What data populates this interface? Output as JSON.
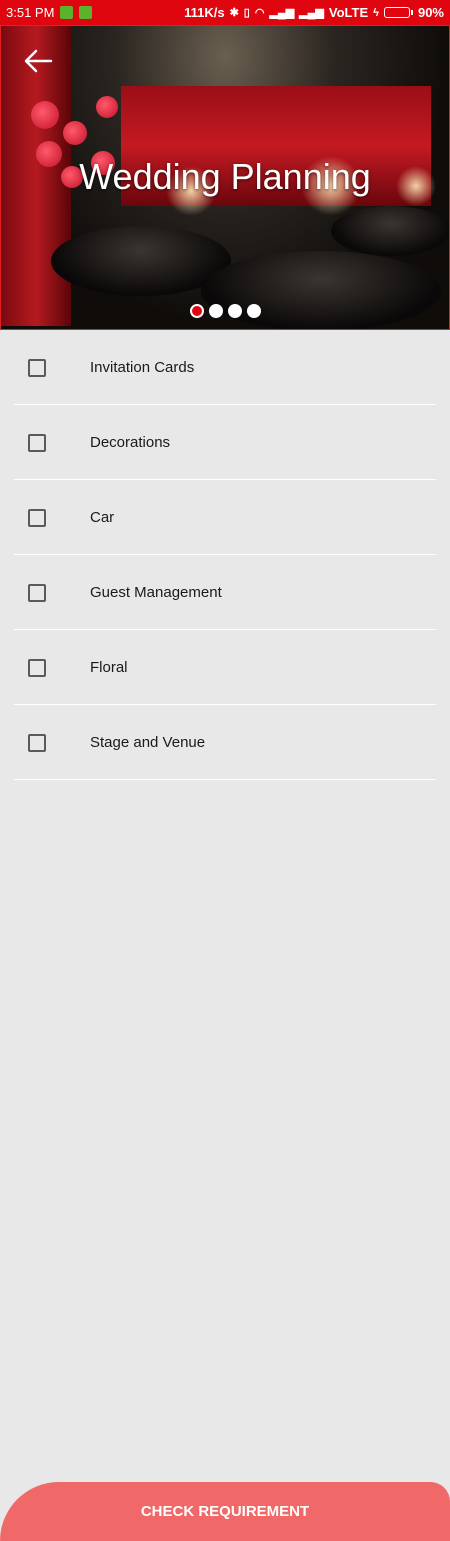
{
  "status_bar": {
    "time": "3:51 PM",
    "network_speed": "111K/s",
    "carrier_label": "VoLTE",
    "battery": "90%",
    "battery_level": 0.9
  },
  "hero": {
    "title": "Wedding Planning",
    "back_icon": "back-arrow-icon",
    "slides_count": 4,
    "active_slide": 1
  },
  "checklist": {
    "items": [
      {
        "label": "Invitation Cards",
        "checked": false
      },
      {
        "label": "Decorations",
        "checked": false
      },
      {
        "label": "Car",
        "checked": false
      },
      {
        "label": "Guest Management",
        "checked": false
      },
      {
        "label": "Floral",
        "checked": false
      },
      {
        "label": "Stage and Venue",
        "checked": false
      }
    ]
  },
  "footer": {
    "cta_label": "CHECK REQUIREMENT"
  },
  "colors": {
    "status_bar": "#e0060f",
    "accent": "#f06868",
    "background": "#e8e8e8"
  }
}
